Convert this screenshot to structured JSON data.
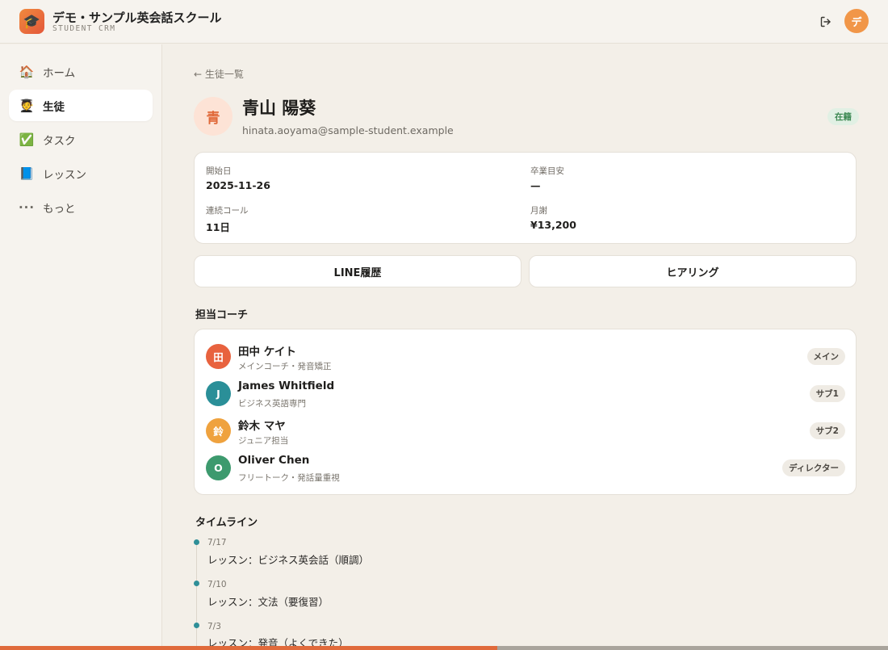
{
  "header": {
    "logo_icon": "graduation-cap-icon",
    "app_title": "デモ・サンプル英会話スクール",
    "app_subtitle": "STUDENT CRM",
    "logout_icon": "logout-icon",
    "user_avatar_initial": "デ"
  },
  "sidebar": {
    "items": [
      {
        "icon": "house-icon",
        "glyph": "🏠",
        "label": "ホーム",
        "active": false
      },
      {
        "icon": "student-icon",
        "glyph": "🧑‍🎓",
        "label": "生徒",
        "active": true
      },
      {
        "icon": "check-icon",
        "glyph": "✅",
        "label": "タスク",
        "active": false
      },
      {
        "icon": "book-icon",
        "glyph": "📘",
        "label": "レッスン",
        "active": false
      },
      {
        "icon": "more-icon",
        "glyph": "···",
        "label": "もっと",
        "active": false
      }
    ]
  },
  "main": {
    "back_link": "← 生徒一覧",
    "student": {
      "avatar_initial": "青",
      "name": "青山 陽葵",
      "email": "hinata.aoyama@sample-student.example",
      "status": "在籍"
    },
    "info": {
      "start_label": "開始日",
      "start_value": "2025-11-26",
      "grad_label": "卒業目安",
      "grad_value": "—",
      "streak_label": "連続コール",
      "streak_value": "11日",
      "fee_label": "月謝",
      "fee_value": "¥13,200"
    },
    "actions": {
      "line_history": "LINE履歴",
      "hearing": "ヒアリング"
    },
    "coaches_title": "担当コーチ",
    "coaches": [
      {
        "initial": "田",
        "name": "田中 ケイト",
        "desc": "メインコーチ・発音矯正",
        "role": "メイン",
        "color": "#e8623e"
      },
      {
        "initial": "J",
        "name": "James Whitfield",
        "desc": "ビジネス英語専門",
        "role": "サブ1",
        "color": "#2a8f98"
      },
      {
        "initial": "鈴",
        "name": "鈴木 マヤ",
        "desc": "ジュニア担当",
        "role": "サブ2",
        "color": "#efa23e"
      },
      {
        "initial": "O",
        "name": "Oliver Chen",
        "desc": "フリートーク・発話量重視",
        "role": "ディレクター",
        "color": "#3d9a6e"
      }
    ],
    "timeline_title": "タイムライン",
    "timeline": [
      {
        "date": "7/17",
        "text": "レッスン：ビジネス英会話（順調）"
      },
      {
        "date": "7/10",
        "text": "レッスン：文法（要復習）"
      },
      {
        "date": "7/3",
        "text": "レッスン：発音（よくできた）"
      }
    ]
  },
  "page_progress": 0.56,
  "colors": {
    "accent": "#e06a3b",
    "status_green": "#3f8a55",
    "timeline_dot": "#2f8f98",
    "background": "#f3efe8"
  }
}
